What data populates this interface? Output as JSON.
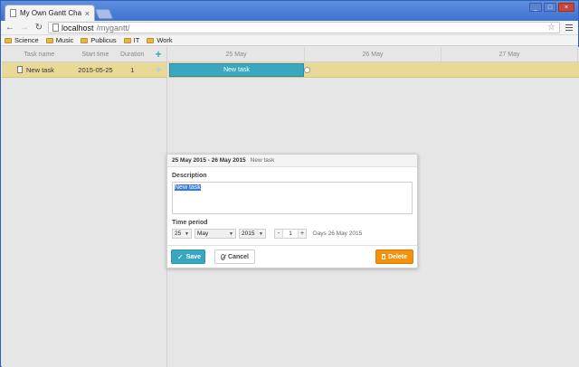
{
  "browser": {
    "tab_title": "My Own Gantt Chart",
    "tab_close": "×",
    "url_host": "localhost",
    "url_path": "/mygantt/",
    "bookmarks": [
      "Science",
      "Music",
      "Publicus",
      "IT",
      "Work"
    ]
  },
  "grid": {
    "headers": {
      "name": "Task name",
      "start": "Start time",
      "duration": "Duration"
    },
    "add_icon": "+",
    "rows": [
      {
        "name": "New task",
        "start": "2015-05-25",
        "duration": "1"
      }
    ]
  },
  "timeline": {
    "scale": [
      "25 May",
      "26 May",
      "27 May"
    ],
    "bar_label": "New task"
  },
  "lightbox": {
    "header_date": "25 May 2015 - 26 May 2015",
    "header_title": "New task",
    "description_label": "Description",
    "description_value": "New task",
    "time_period_label": "Time period",
    "day": "25",
    "month": "May",
    "year": "2015",
    "duration_minus": "-",
    "duration_value": "1",
    "duration_plus": "+",
    "days_text": "Days 26 May 2015",
    "save_label": "Save",
    "cancel_label": "Cancel",
    "delete_label": "Delete"
  },
  "colors": {
    "accent": "#3aa7c0",
    "selected_row": "#e8d996",
    "delete": "#f3920c"
  }
}
